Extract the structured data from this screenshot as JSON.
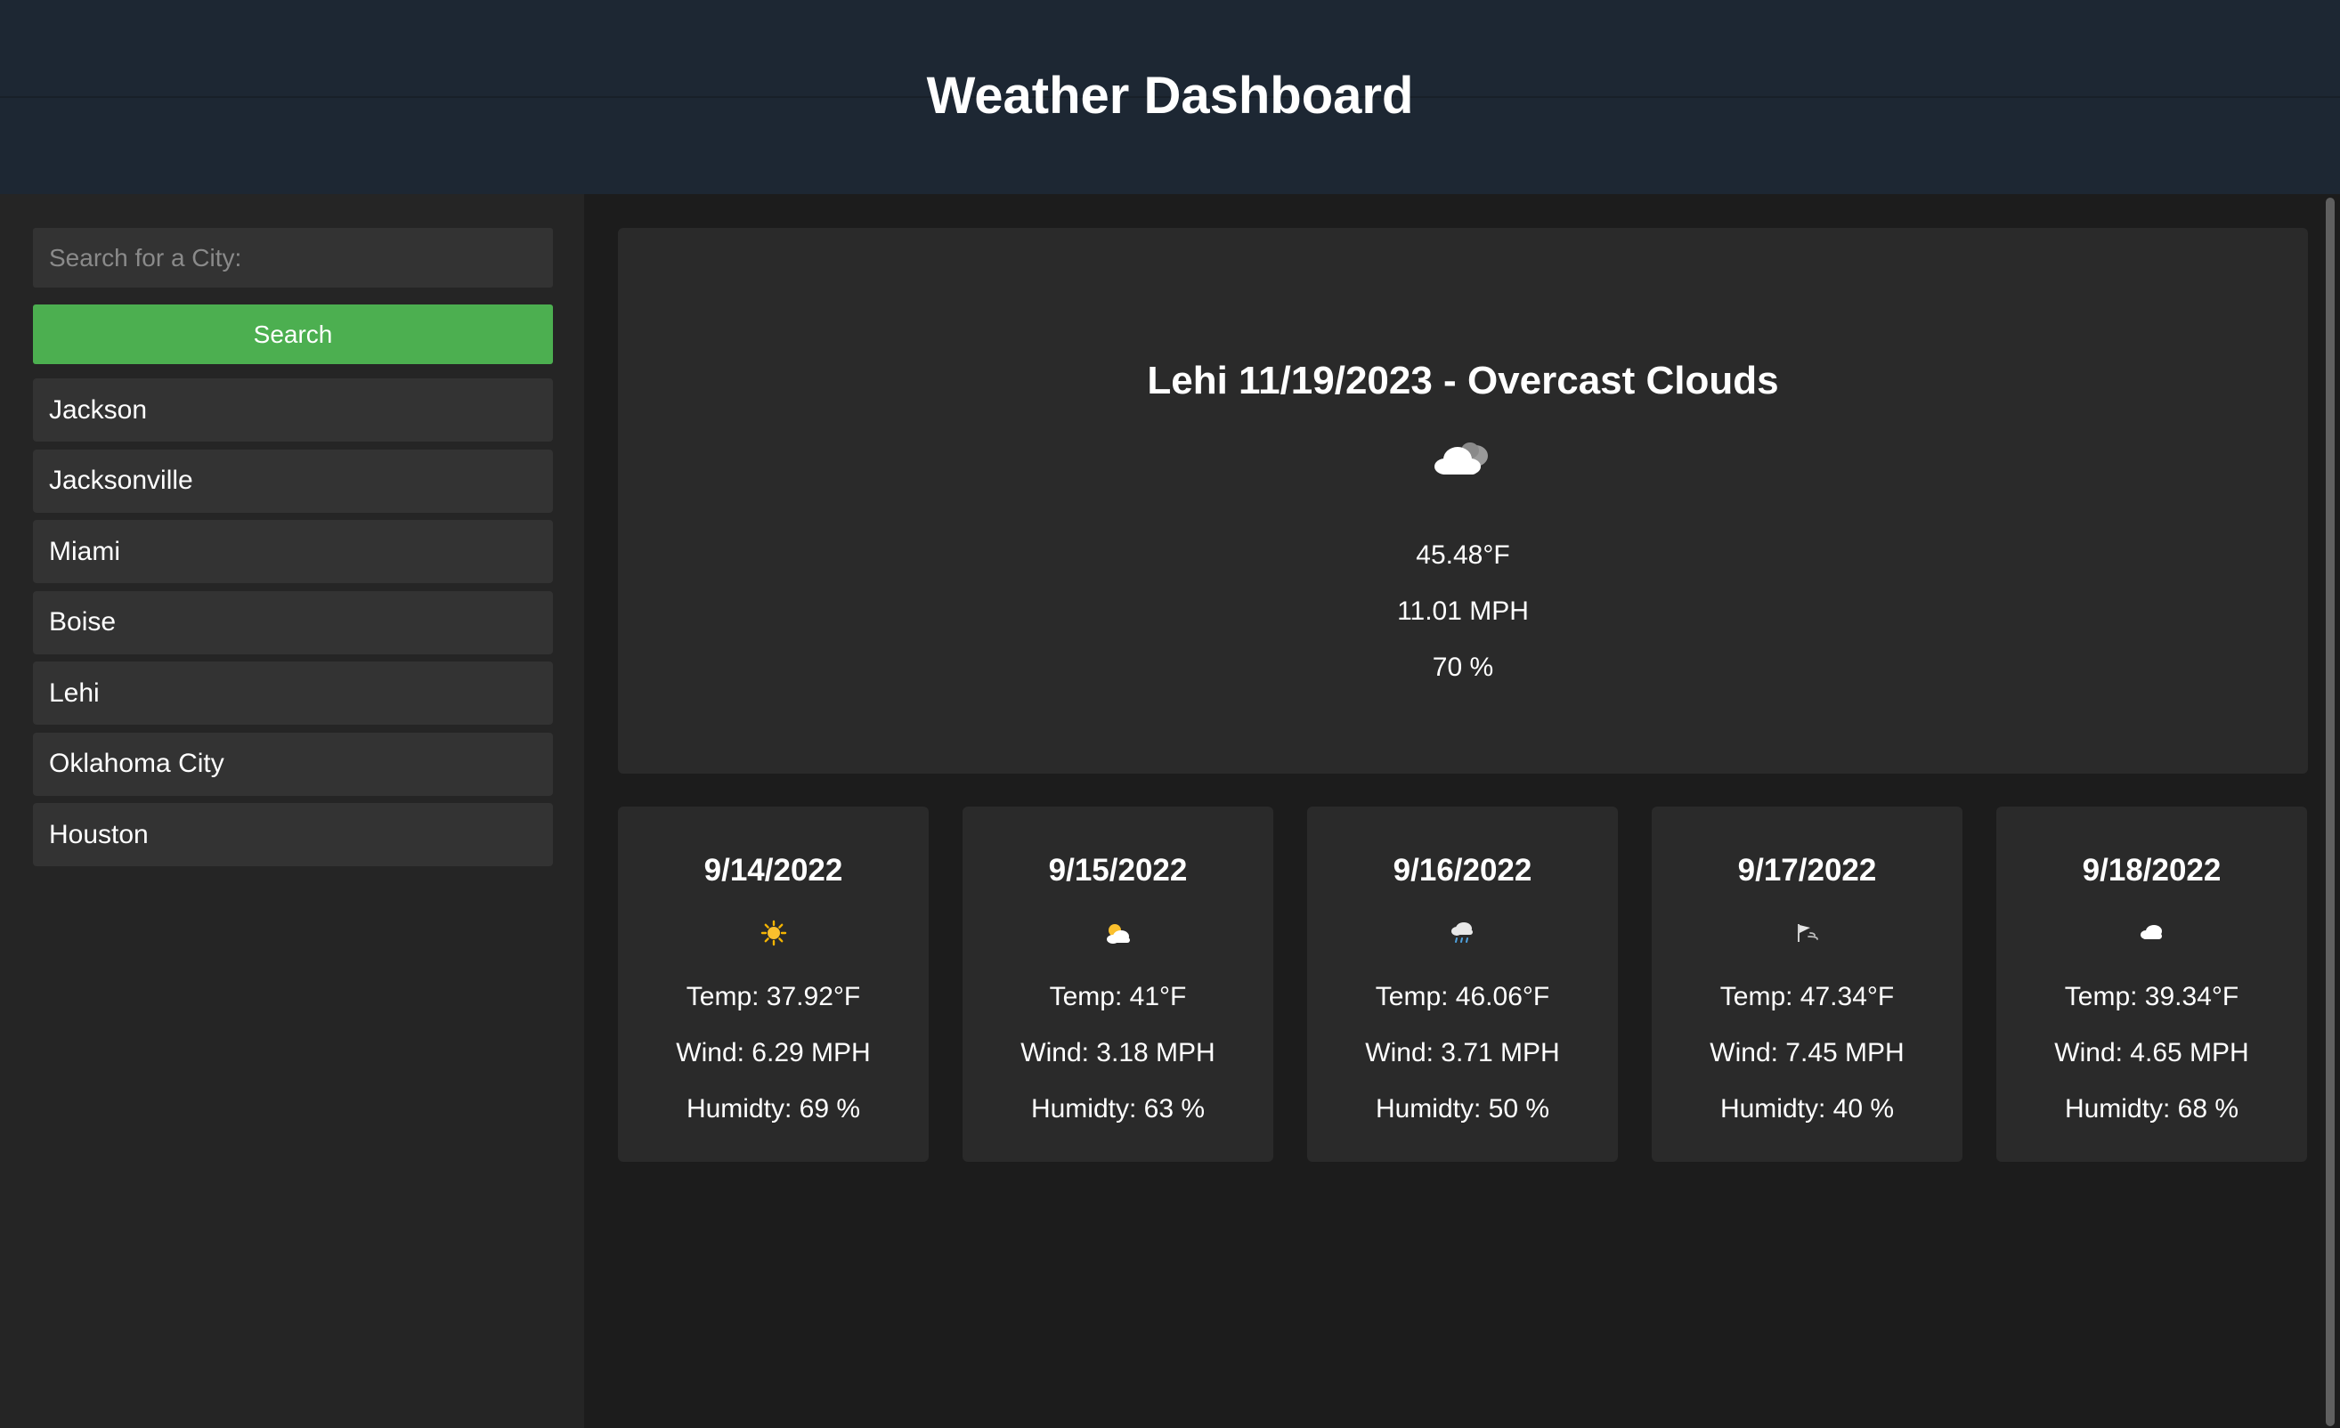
{
  "header": {
    "title": "Weather Dashboard"
  },
  "sidebar": {
    "search_placeholder": "Search for a City:",
    "search_value": "",
    "search_button_label": "Search",
    "history": [
      "Jackson",
      "Jacksonville",
      "Miami",
      "Boise",
      "Lehi",
      "Oklahoma City",
      "Houston"
    ]
  },
  "current": {
    "title": "Lehi 11/19/2023 - Overcast Clouds",
    "icon": "overcast-clouds-icon",
    "temp": "45.48°F",
    "wind": "11.01 MPH",
    "humidity": "70 %"
  },
  "forecast": [
    {
      "date": "9/14/2022",
      "icon": "sun-icon",
      "temp": "Temp: 37.92°F",
      "wind": "Wind: 6.29 MPH",
      "humidity": "Humidty: 69 %"
    },
    {
      "date": "9/15/2022",
      "icon": "partly-cloudy-icon",
      "temp": "Temp: 41°F",
      "wind": "Wind: 3.18 MPH",
      "humidity": "Humidty: 63 %"
    },
    {
      "date": "9/16/2022",
      "icon": "rain-icon",
      "temp": "Temp: 46.06°F",
      "wind": "Wind: 3.71 MPH",
      "humidity": "Humidty: 50 %"
    },
    {
      "date": "9/17/2022",
      "icon": "wind-icon",
      "temp": "Temp: 47.34°F",
      "wind": "Wind: 7.45 MPH",
      "humidity": "Humidty: 40 %"
    },
    {
      "date": "9/18/2022",
      "icon": "cloud-icon",
      "temp": "Temp: 39.34°F",
      "wind": "Wind: 4.65 MPH",
      "humidity": "Humidty: 68 %"
    }
  ],
  "colors": {
    "header_bg": "#1d2733",
    "sidebar_bg": "#252525",
    "main_bg": "#1c1c1c",
    "card_bg": "#2a2a2a",
    "accent": "#4caf50"
  }
}
